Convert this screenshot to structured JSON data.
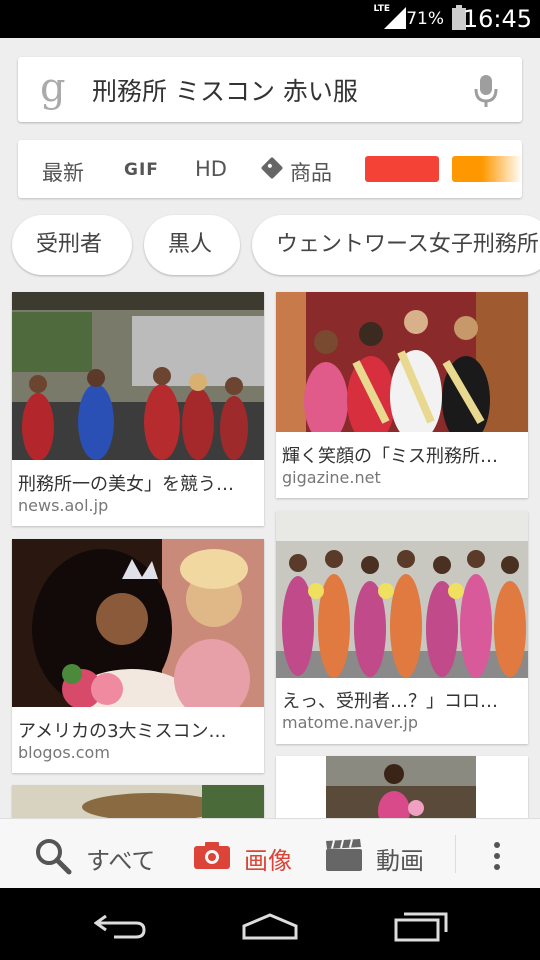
{
  "status_bar": {
    "network": "LTE",
    "battery": "71%",
    "time": "16:45"
  },
  "search": {
    "logo": "g",
    "query": "刑務所 ミスコン 赤い服",
    "mic_icon": "microphone-icon"
  },
  "filters": {
    "items": [
      "最新",
      "GIF",
      "HD",
      "商品"
    ],
    "swatches": [
      "#f44336",
      "#ff9800"
    ]
  },
  "chips": [
    "受刑者",
    "黒人",
    "ウェントワース女子刑務所"
  ],
  "results": [
    {
      "title": "刑務所一の美女」を競う…",
      "source": "news.aol.jp"
    },
    {
      "title": "輝く笑顔の「ミス刑務所…",
      "source": "gigazine.net"
    },
    {
      "title": "アメリカの3大ミスコン…",
      "source": "blogos.com"
    },
    {
      "title": "えっ、受刑者…？」コロ…",
      "source": "matome.naver.jp"
    }
  ],
  "bottom_nav": {
    "all": "すべて",
    "images": "画像",
    "videos": "動画",
    "active_color": "#db4437"
  }
}
